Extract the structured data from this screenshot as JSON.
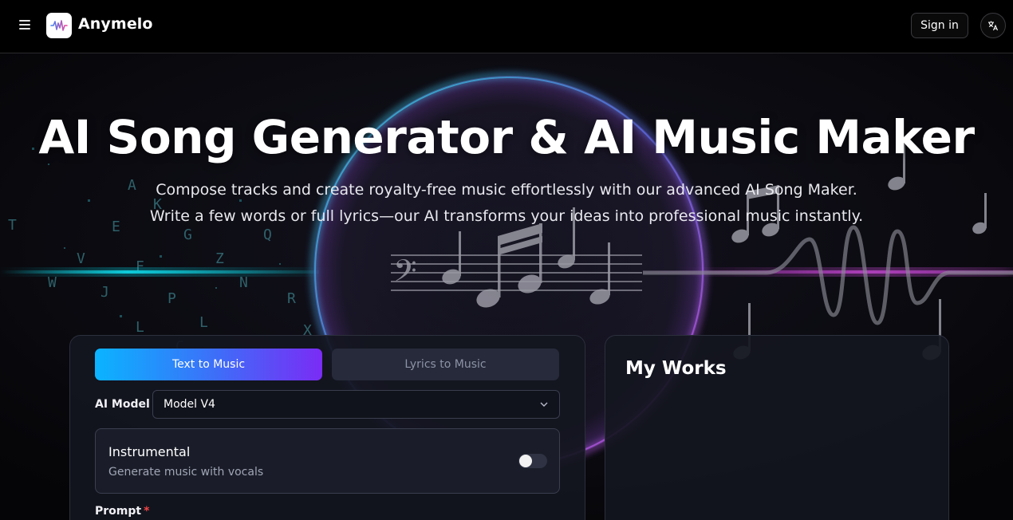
{
  "header": {
    "brand": "Anymelo",
    "signin_label": "Sign in",
    "icons": {
      "menu": "menu-icon",
      "logo": "waveform-logo-icon",
      "language": "translate-icon"
    }
  },
  "hero": {
    "title": "AI Song Generator & AI Music Maker",
    "subtitle_line1": "Compose tracks and create royalty-free music effortlessly with our advanced AI Song Maker.",
    "subtitle_line2": "Write a few words or full lyrics—our AI transforms your ideas into professional music instantly."
  },
  "generator": {
    "tabs": [
      {
        "label": "Text to Music",
        "active": true
      },
      {
        "label": "Lyrics to Music",
        "active": false
      }
    ],
    "model_label": "AI Model",
    "model_value": "Model V4",
    "instrumental": {
      "title": "Instrumental",
      "description": "Generate music with vocals",
      "enabled": false
    },
    "prompt_label": "Prompt",
    "required_marker": "*"
  },
  "works": {
    "title": "My Works"
  },
  "colors": {
    "accent_start": "#0ab4ff",
    "accent_end": "#7a2cf5",
    "panel_bg": "#141620",
    "required": "#ef4444"
  }
}
